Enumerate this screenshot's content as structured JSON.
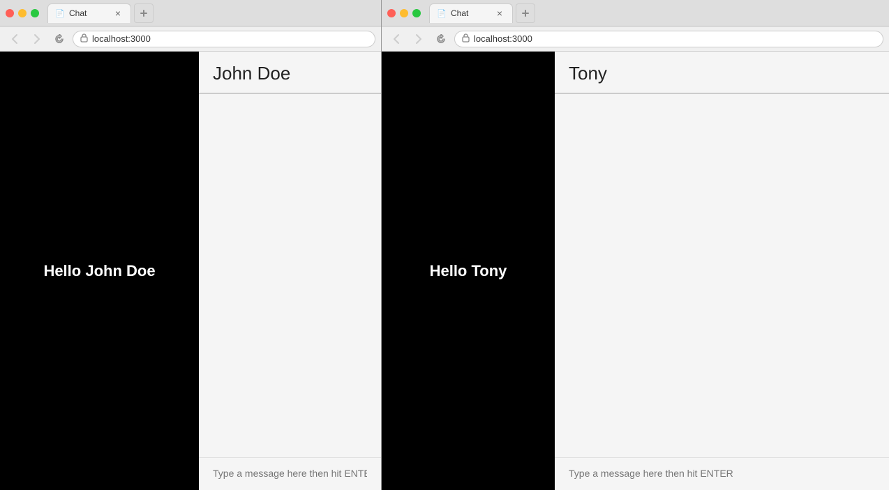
{
  "browser1": {
    "tab_title": "Chat",
    "url": "localhost:3000",
    "nav": {
      "back_label": "←",
      "forward_label": "→",
      "reload_label": "↻"
    },
    "sidebar": {
      "greeting": "Hello John Doe"
    },
    "chat": {
      "user_name": "John Doe",
      "input_placeholder": "Type a message here then hit ENTER"
    }
  },
  "browser2": {
    "tab_title": "Chat",
    "url": "localhost:3000",
    "nav": {
      "back_label": "←",
      "forward_label": "→",
      "reload_label": "↻"
    },
    "sidebar": {
      "greeting": "Hello Tony"
    },
    "chat": {
      "user_name": "Tony",
      "input_placeholder": "Type a message here then hit ENTER"
    }
  },
  "icons": {
    "tab_icon": "📄",
    "close_icon": "×",
    "lock_icon": "🔒"
  }
}
